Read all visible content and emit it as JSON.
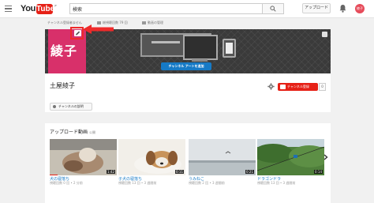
{
  "masthead": {
    "logo_you": "You",
    "logo_tube": "Tube",
    "logo_region": "JP",
    "search_value": "検索",
    "upload_label": "アップロード",
    "avatar_text": "綾子"
  },
  "subnav": {
    "not_registered": "チャンネル登録者ません",
    "views": "総視聴回数 79 回",
    "video_manager": "動画の管理"
  },
  "channel": {
    "icon_text": "綾子",
    "add_art_label": "チャンネル アートを追加",
    "name": "土屋綾子",
    "subscribe_label": "チャンネル登録",
    "subscriber_count": "0",
    "about_label": "チャンネルの説明"
  },
  "uploads": {
    "title": "アップロード動画",
    "visibility": "公開",
    "videos": [
      {
        "title": "犬の寝落ち",
        "meta": "視聴回数 0 回 • 2 分前",
        "duration": "1:42"
      },
      {
        "title": "子犬の寝落ち",
        "meta": "視聴回数 13 回 • 3 週間前",
        "duration": "0:11"
      },
      {
        "title": "うみねこ",
        "meta": "視聴回数 2 回 • 3 週間前",
        "duration": "0:21"
      },
      {
        "title": "ドラゴンドラ",
        "meta": "視聴回数 13 回 • 3 週間前",
        "duration": "0:14"
      }
    ]
  },
  "colors": {
    "brand_red": "#e62117",
    "channel_icon_bg": "#d8306a",
    "link_blue": "#167ac6",
    "annotation_red": "#ee2a2a"
  }
}
